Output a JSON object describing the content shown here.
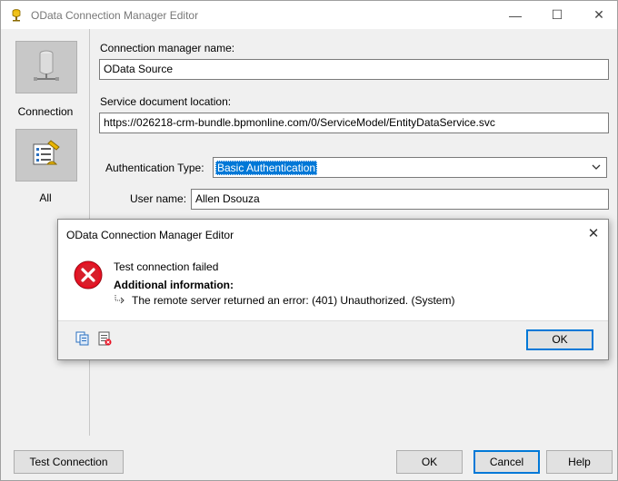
{
  "window": {
    "title": "OData Connection Manager Editor",
    "minimize": "—",
    "maximize": "☐",
    "close": "✕"
  },
  "sidebar": {
    "items": [
      {
        "label": "Connection",
        "icon": "database-connection-icon"
      },
      {
        "label": "All",
        "icon": "properties-list-icon"
      }
    ]
  },
  "form": {
    "connection_name_label": "Connection manager name:",
    "connection_name_value": "OData Source",
    "service_location_label": "Service document location:",
    "service_location_value": "https://026218-crm-bundle.bpmonline.com/0/ServiceModel/EntityDataService.svc",
    "auth_type_label": "Authentication Type:",
    "auth_type_value": "Basic Authentication",
    "username_label": "User name:",
    "username_value": "Allen Dsouza"
  },
  "buttons": {
    "test_connection": "Test Connection",
    "ok": "OK",
    "cancel": "Cancel",
    "help": "Help"
  },
  "dialog": {
    "title": "OData Connection Manager Editor",
    "close": "✕",
    "message": "Test connection failed",
    "additional_heading": "Additional information:",
    "detail": "The remote server returned an error: (401) Unauthorized. (System)",
    "ok": "OK",
    "error_color": "#e81123"
  }
}
